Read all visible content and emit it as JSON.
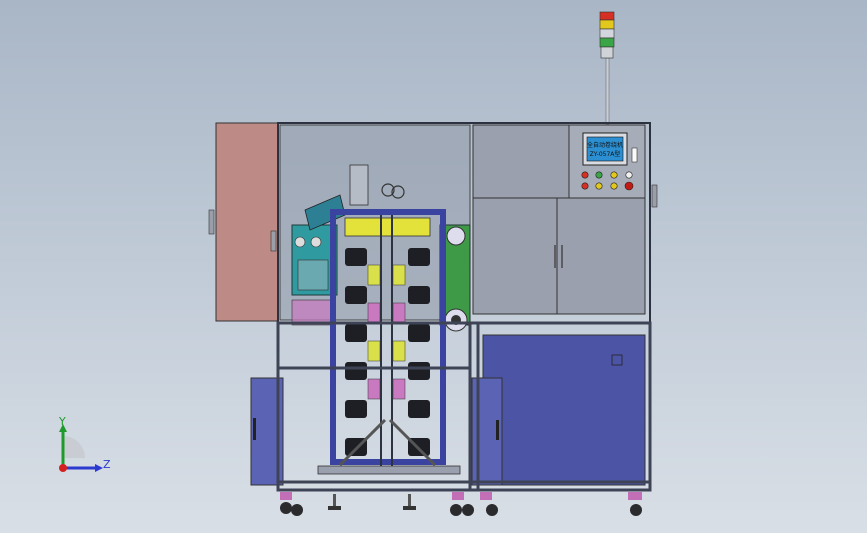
{
  "model": {
    "hmi_screen": {
      "line1": "全自动卷绕机",
      "line2": "ZY-057A型"
    }
  },
  "triad": {
    "y_label": "Y",
    "z_label": "Z"
  },
  "colors": {
    "background_top": "#a9b6c6",
    "background_bottom": "#d9dfe6",
    "panel_gray": "#9aa0ad",
    "door_pink": "#bd8a86",
    "cabinet_blue": "#4c54a6",
    "cabinet_blue_light": "#5a63b4",
    "frame_dark": "#3e4456",
    "roller_black": "#1e1f24",
    "accent_yellow": "#e4e23a",
    "accent_teal": "#2e9aa0",
    "lamp_red": "#e0241f",
    "lamp_yellow": "#e8c81a",
    "lamp_green": "#2aa63c"
  },
  "icons": [
    "signal-tower-icon",
    "axis-triad-icon",
    "caster-wheel-icon",
    "push-button-icon"
  ]
}
